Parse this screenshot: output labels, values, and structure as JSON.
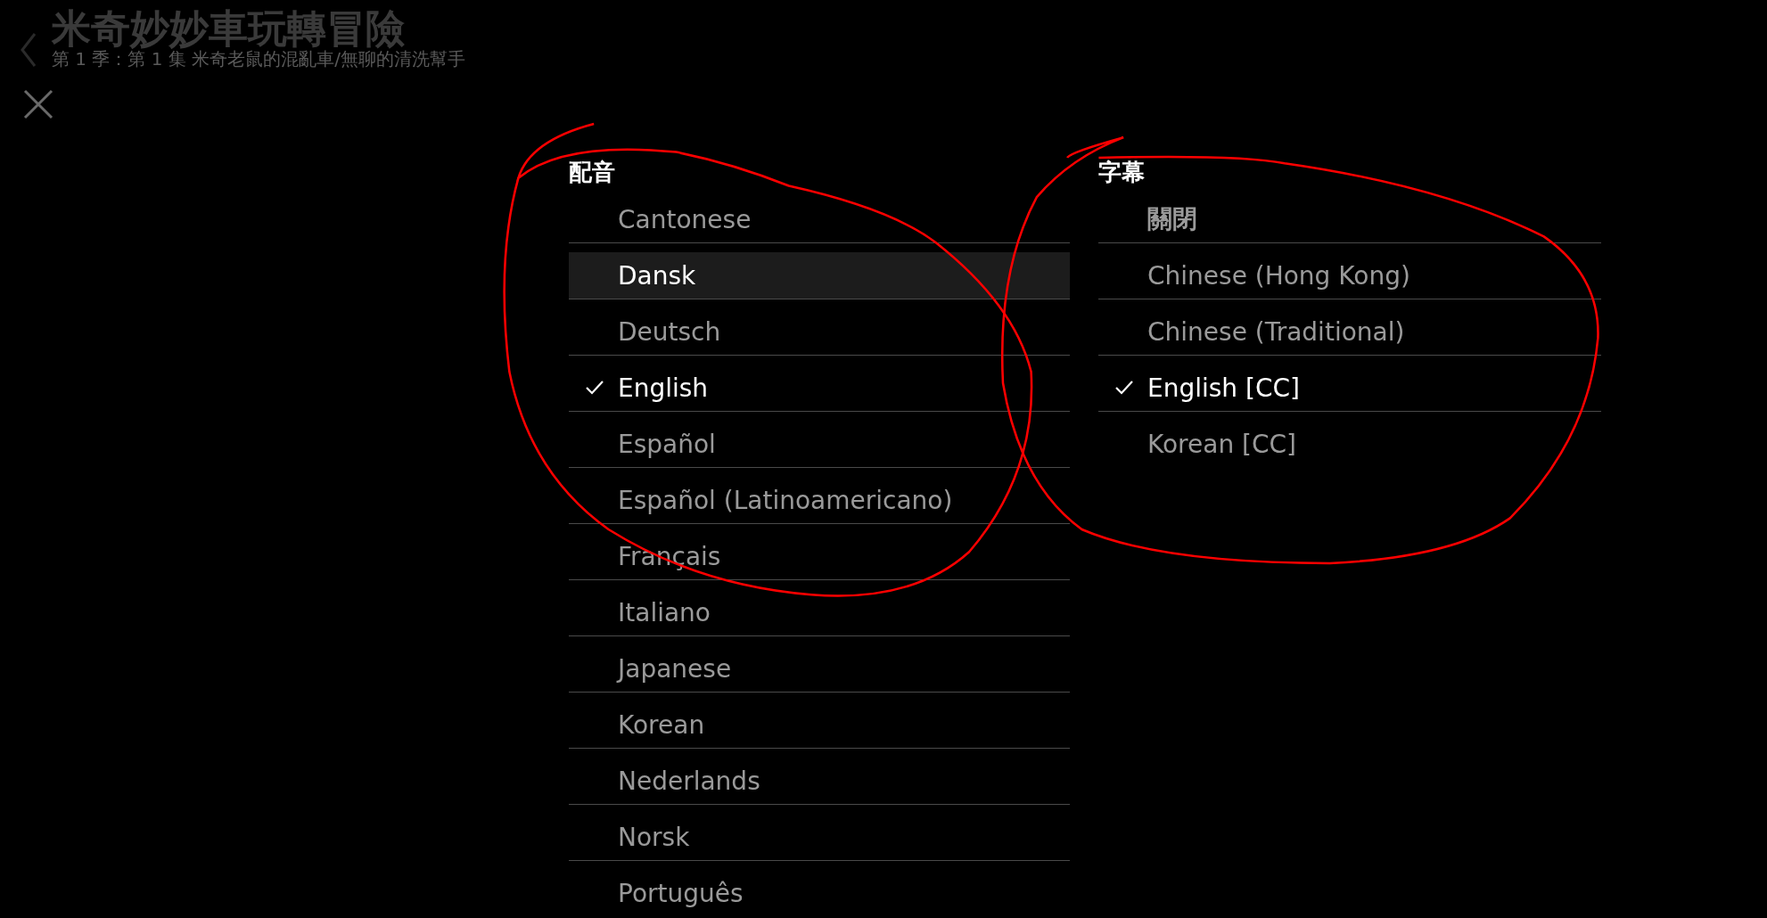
{
  "header": {
    "title": "米奇妙妙車玩轉冒險",
    "subtitle": "第 1 季：第 1 集 米奇老鼠的混亂車/無聊的清洗幫手"
  },
  "audio": {
    "heading": "配音",
    "items": [
      {
        "label": "Cantonese",
        "selected": false,
        "highlighted": false
      },
      {
        "label": "Dansk",
        "selected": false,
        "highlighted": true
      },
      {
        "label": "Deutsch",
        "selected": false,
        "highlighted": false
      },
      {
        "label": "English",
        "selected": true,
        "highlighted": false
      },
      {
        "label": "Español",
        "selected": false,
        "highlighted": false
      },
      {
        "label": "Español (Latinoamericano)",
        "selected": false,
        "highlighted": false
      },
      {
        "label": "Français",
        "selected": false,
        "highlighted": false
      },
      {
        "label": "Italiano",
        "selected": false,
        "highlighted": false
      },
      {
        "label": "Japanese",
        "selected": false,
        "highlighted": false
      },
      {
        "label": "Korean",
        "selected": false,
        "highlighted": false
      },
      {
        "label": "Nederlands",
        "selected": false,
        "highlighted": false
      },
      {
        "label": "Norsk",
        "selected": false,
        "highlighted": false
      },
      {
        "label": "Português",
        "selected": false,
        "highlighted": false
      }
    ]
  },
  "subtitles": {
    "heading": "字幕",
    "items": [
      {
        "label": "關閉",
        "selected": false,
        "highlighted": false
      },
      {
        "label": "Chinese (Hong Kong)",
        "selected": false,
        "highlighted": false
      },
      {
        "label": "Chinese (Traditional)",
        "selected": false,
        "highlighted": false
      },
      {
        "label": "English [CC]",
        "selected": true,
        "highlighted": false
      },
      {
        "label": "Korean [CC]",
        "selected": false,
        "highlighted": false
      }
    ]
  }
}
